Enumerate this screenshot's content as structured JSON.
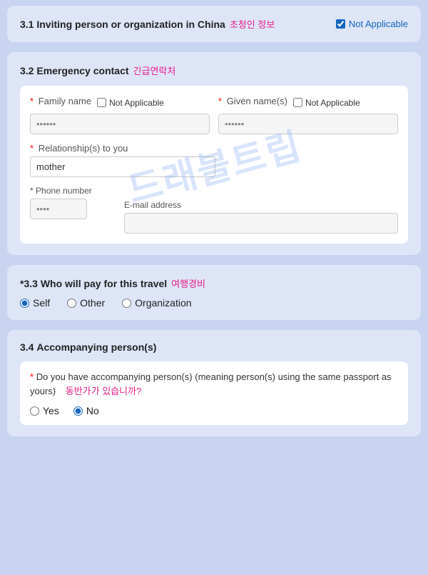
{
  "sections": {
    "s31": {
      "number": "3.1",
      "title": "Inviting person or organization in China",
      "title_korean": "초청인 정보",
      "not_applicable_label": "Not Applicable",
      "not_applicable_checked": true
    },
    "s32": {
      "number": "3.2",
      "title": "Emergency contact",
      "title_korean": "긴급연락처",
      "family_name_label": "Family name",
      "family_name_not_applicable": "Not Applicable",
      "given_name_label": "Given name(s)",
      "given_name_not_applicable": "Not Applicable",
      "family_name_placeholder": "••••••",
      "given_name_placeholder": "••••••",
      "relationship_label": "Relationship(s) to you",
      "relationship_value": "mother",
      "phone_label": "Phone number",
      "phone_placeholder": "••••",
      "email_label": "E-mail address",
      "email_placeholder": ""
    },
    "s33": {
      "number": "*3.3",
      "title": "Who will pay for this travel",
      "title_korean": "여행경비",
      "options": [
        "Self",
        "Other",
        "Organization"
      ],
      "selected": "Self"
    },
    "s34": {
      "number": "3.4",
      "title": "Accompanying person(s)",
      "question": "Do you have accompanying person(s) (meaning person(s) using the same passport as yours)",
      "question_korean": "동반가가 있습니까?",
      "yes_label": "Yes",
      "no_label": "No",
      "selected": "No"
    }
  },
  "watermark": "드래블트립"
}
